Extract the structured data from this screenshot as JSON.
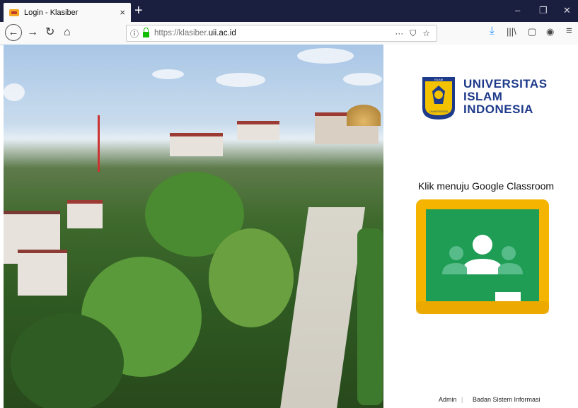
{
  "browser": {
    "tab_title": "Login - Klasiber",
    "tab_close": "×",
    "new_tab": "+",
    "window_controls": {
      "minimize": "–",
      "restore": "❐",
      "close": "✕"
    },
    "nav": {
      "back": "←",
      "forward": "→",
      "reload": "↻",
      "home": "⌂"
    },
    "url": {
      "prefix": "https://klasiber.",
      "domain": "uii.ac.id"
    },
    "url_icons": {
      "info": "ⓘ",
      "more": "···",
      "pocket": "⛉",
      "bookmark": "☆"
    },
    "toolbar_icons": {
      "download": "⤓",
      "library": "|||\\",
      "sidebar": "▢",
      "account": "◉",
      "menu": "≡"
    }
  },
  "page": {
    "logo_lines": [
      "UNIVERSITAS",
      "ISLAM",
      "INDONESIA"
    ],
    "logo_seal_text": [
      "ISLAM",
      "INDONESIA",
      "UNIVERSITAS"
    ],
    "classroom_label": "Klik menuju Google Classroom",
    "footer": {
      "admin": "Admin",
      "separator": "|",
      "bsi": "Badan Sistem Informasi"
    }
  },
  "colors": {
    "tabbar": "#1b1f3f",
    "brand_blue": "#1e3a8a",
    "classroom_yellow": "#f5b400",
    "classroom_green": "#1f9d55"
  }
}
